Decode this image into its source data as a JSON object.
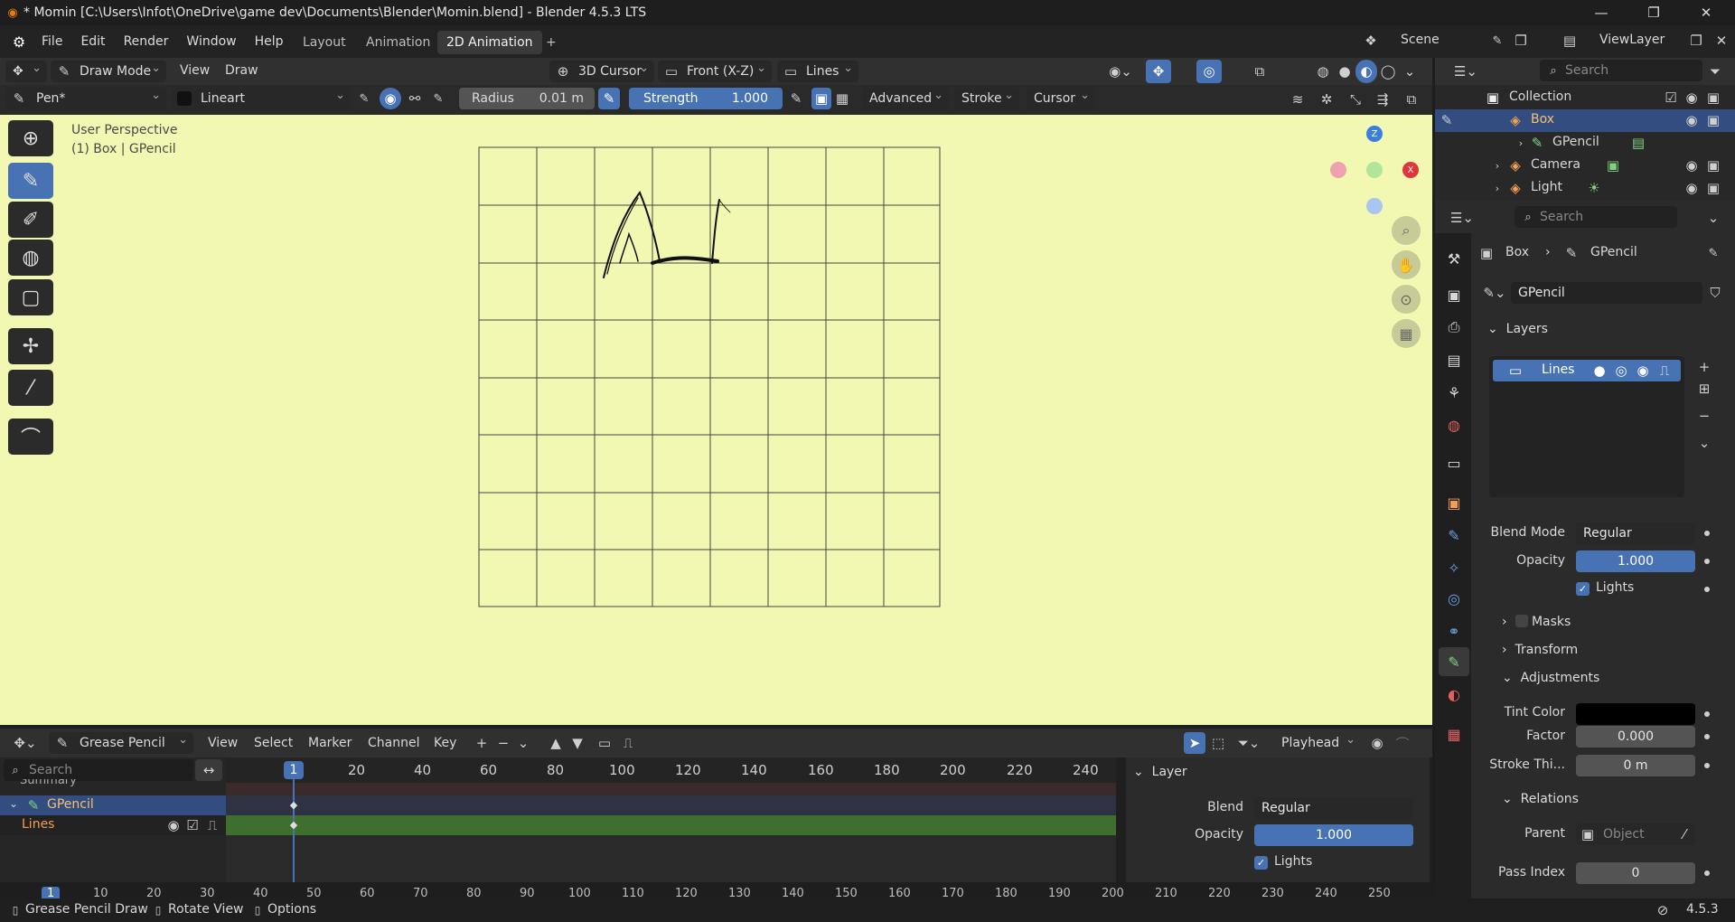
{
  "titlebar": {
    "title": "* Momin [C:\\Users\\Infot\\OneDrive\\game dev\\Documents\\Blender\\Momin.blend] - Blender 4.5.3 LTS"
  },
  "menus": [
    "File",
    "Edit",
    "Render",
    "Window",
    "Help"
  ],
  "workspaces": [
    "Layout",
    "Animation",
    "2D Animation",
    "+"
  ],
  "active_workspace": "2D Animation",
  "scene": "Scene",
  "view_layer": "ViewLayer",
  "header": {
    "mode": "Draw Mode",
    "view": "View",
    "draw": "Draw",
    "cursor": "3D Cursor",
    "orientation": "Front (X-Z)",
    "layer": "Lines"
  },
  "toolsettings": {
    "brush": "Pen*",
    "material": "Lineart",
    "radius_label": "Radius",
    "radius_value": "0.01 m",
    "strength_label": "Strength",
    "strength_value": "1.000",
    "advanced": "Advanced",
    "stroke": "Stroke",
    "cursor": "Cursor"
  },
  "viewport": {
    "perspective": "User Perspective",
    "object_info": "(1) Box | GPencil",
    "gizmo": {
      "z": "Z",
      "x": "X"
    }
  },
  "outliner": {
    "search_placeholder": "Search",
    "rows": [
      "Collection",
      "Box",
      "GPencil",
      "Camera",
      "Light"
    ]
  },
  "properties": {
    "search_placeholder": "Search",
    "breadcrumb": [
      "Box",
      "GPencil"
    ],
    "data_name": "GPencil",
    "layers_section": "Layers",
    "layer_item": "Lines",
    "blend_mode_label": "Blend Mode",
    "blend_mode_value": "Regular",
    "opacity_label": "Opacity",
    "opacity_value": "1.000",
    "lights_label": "Lights",
    "masks": "Masks",
    "transform": "Transform",
    "adjustments": "Adjustments",
    "tint_color_label": "Tint Color",
    "tint_color_hex": "#000000",
    "factor_label": "Factor",
    "factor_value": "0.000",
    "stroke_thickness_label": "Stroke Thi...",
    "stroke_thickness_value": "0 m",
    "relations": "Relations",
    "parent_label": "Parent",
    "parent_value": "Object",
    "pass_index_label": "Pass Index",
    "pass_index_value": "0"
  },
  "timeline": {
    "editor_mode": "Grease Pencil",
    "menus": [
      "View",
      "Select",
      "Marker",
      "Channel",
      "Key"
    ],
    "playhead": "Playhead",
    "search_placeholder": "Search",
    "summary": "Summary",
    "channel_object": "GPencil",
    "channel_layer": "Lines",
    "current_frame": "1",
    "ruler_frames": [
      "20",
      "40",
      "60",
      "80",
      "100",
      "120",
      "140",
      "160",
      "180",
      "200",
      "220",
      "240"
    ],
    "bottom_frames": [
      "1",
      "10",
      "20",
      "30",
      "40",
      "50",
      "60",
      "70",
      "80",
      "90",
      "100",
      "110",
      "120",
      "130",
      "140",
      "150",
      "160",
      "170",
      "180",
      "190",
      "200",
      "210",
      "220",
      "230",
      "240",
      "250"
    ],
    "layer_panel_title": "Layer",
    "blend_label": "Blend",
    "blend_value": "Regular",
    "opacity_label": "Opacity",
    "opacity_value": "1.000",
    "lights_label": "Lights"
  },
  "statusbar": {
    "item1": "Grease Pencil Draw",
    "item2": "Rotate View",
    "item3": "Options",
    "version": "4.5.3"
  },
  "colors": {
    "viewport_bg": "#f2f7b2",
    "accent": "#4772b3",
    "channel_green": "#3f6f2e",
    "axis_x": "#e0343f",
    "axis_z": "#3a7fe0"
  }
}
